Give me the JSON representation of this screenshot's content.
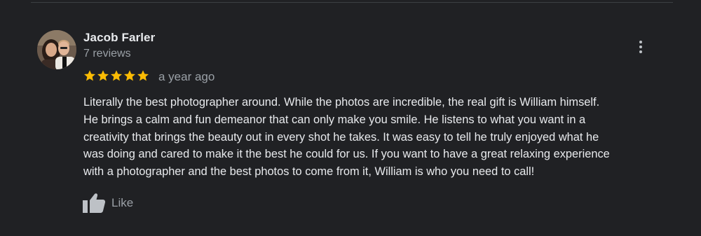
{
  "review": {
    "author_name": "Jacob Farler",
    "author_meta": "7 reviews",
    "rating": 5,
    "rating_max": 5,
    "time_ago": "a year ago",
    "text_lines": [
      "Literally the best photographer around. While the photos are incredible, the real gift is William himself.",
      "He brings a calm and fun demeanor that can only make you smile. He listens to what you want in a",
      "creativity that brings the beauty out in every shot he takes. It was easy to tell he truly enjoyed what he",
      "was doing and cared to make it the best he could for us. If you want to have a great relaxing experience",
      "with a photographer and the best photos to come from it, William is who you need to call!"
    ],
    "like_label": "Like"
  },
  "icons": {
    "avatar": "profile-photo",
    "more": "more-vert-icon",
    "star": "star-icon",
    "like": "thumbs-up-icon"
  },
  "colors": {
    "background": "#202124",
    "star": "#fbbc04",
    "primary_text": "#e8eaed",
    "secondary_text": "#9aa0a6"
  }
}
